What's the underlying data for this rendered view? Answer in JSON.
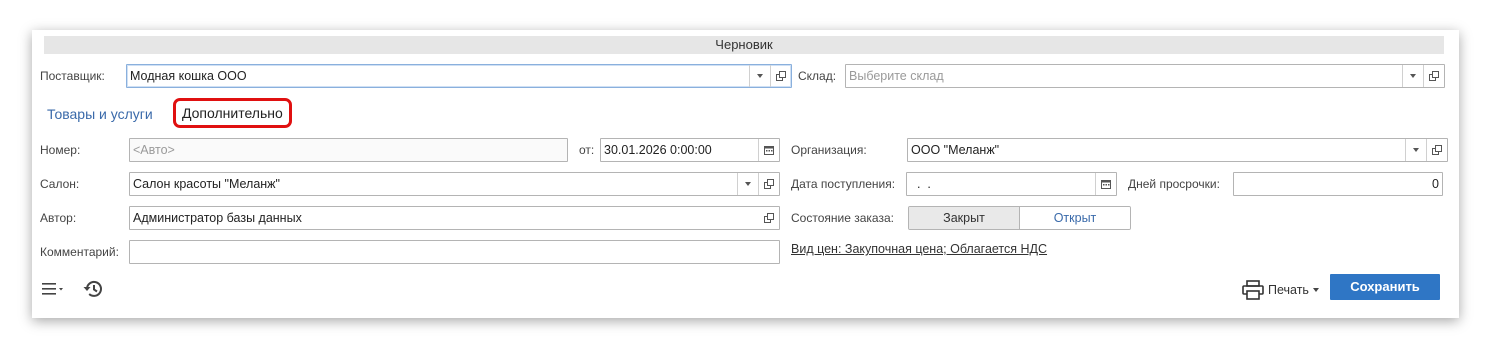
{
  "header": {
    "title": "Черновик"
  },
  "supplier": {
    "label": "Поставщик:",
    "value": "Модная кошка ООО"
  },
  "warehouse": {
    "label": "Склад:",
    "placeholder": "Выберите склад"
  },
  "tabs": [
    {
      "label": "Товары и услуги",
      "active": false
    },
    {
      "label": "Дополнительно",
      "active": true
    }
  ],
  "number": {
    "label": "Номер:",
    "placeholder": "<Авто>"
  },
  "date": {
    "label": "от:",
    "value": "30.01.2026  0:00:00"
  },
  "organization": {
    "label": "Организация:",
    "value": "ООО \"Меланж\""
  },
  "salon": {
    "label": "Салон:",
    "value": "Салон красоты \"Меланж\""
  },
  "arrival_date": {
    "label": "Дата поступления:",
    "value": "  .  ."
  },
  "overdue_days": {
    "label": "Дней просрочки:",
    "value": "0"
  },
  "author": {
    "label": "Автор:",
    "value": "Администратор базы данных"
  },
  "order_state": {
    "label": "Состояние заказа:",
    "options": [
      "Закрыт",
      "Открыт"
    ],
    "selected": "Закрыт"
  },
  "comment": {
    "label": "Комментарий:",
    "value": ""
  },
  "price_link": {
    "label": "Вид цен: Закупочная цена; Облагается НДС"
  },
  "footer": {
    "print_label": "Печать",
    "save_label": "Сохранить"
  },
  "colors": {
    "accent": "#2f76c5",
    "link": "#3a6aaa",
    "highlight": "#e01010"
  }
}
